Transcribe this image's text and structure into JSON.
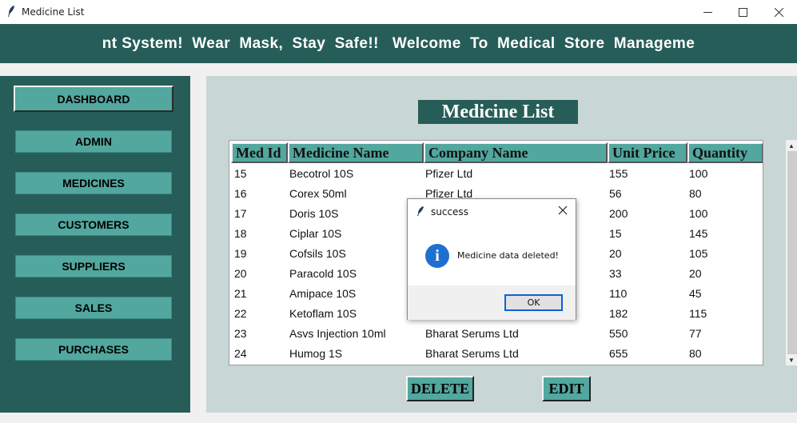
{
  "window": {
    "title": "Medicine List",
    "icon": "feather-icon"
  },
  "banner": {
    "text": "nt System!  Wear  Mask,  Stay  Safe!!   Welcome  To  Medical  Store  Manageme"
  },
  "sidebar": {
    "items": [
      {
        "label": "DASHBOARD",
        "active": true
      },
      {
        "label": "ADMIN"
      },
      {
        "label": "MEDICINES"
      },
      {
        "label": "CUSTOMERS"
      },
      {
        "label": "SUPPLIERS"
      },
      {
        "label": "SALES"
      },
      {
        "label": "PURCHASES"
      }
    ]
  },
  "main": {
    "heading": "Medicine List",
    "columns": [
      "Med Id",
      "Medicine Name",
      "Company Name",
      "Unit Price",
      "Quantity"
    ],
    "rows": [
      [
        "15",
        "Becotrol 10S",
        "Pfizer Ltd",
        "155",
        "100"
      ],
      [
        "16",
        "Corex 50ml",
        "Pfizer Ltd",
        "56",
        "80"
      ],
      [
        "17",
        "Doris 10S",
        "",
        "200",
        "100"
      ],
      [
        "18",
        "Ciplar 10S",
        "",
        "15",
        "145"
      ],
      [
        "19",
        "Cofsils 10S",
        "",
        "20",
        "105"
      ],
      [
        "20",
        "Paracold 10S",
        "",
        "33",
        "20"
      ],
      [
        "21",
        "Amipace 10S",
        "",
        "110",
        "45"
      ],
      [
        "22",
        "Ketoflam 10S",
        "",
        "182",
        "115"
      ],
      [
        "23",
        "Asvs Injection 10ml",
        "Bharat Serums Ltd",
        "550",
        "77"
      ],
      [
        "24",
        "Humog 1S",
        "Bharat Serums Ltd",
        "655",
        "80"
      ]
    ],
    "delete_label": "DELETE",
    "edit_label": "EDIT"
  },
  "dialog": {
    "title": "success",
    "message": "Medicine data deleted!",
    "ok_label": "OK",
    "icon": "info-icon"
  },
  "colors": {
    "dark_teal": "#275d58",
    "teal": "#52a79f",
    "panel_bg": "#c9d6d6"
  }
}
